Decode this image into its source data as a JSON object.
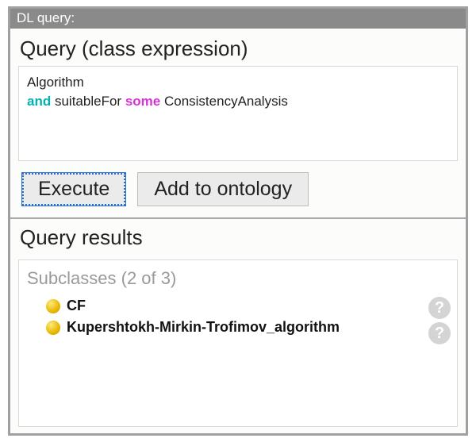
{
  "window": {
    "title": "DL query:"
  },
  "query": {
    "section_label": "Query (class expression)",
    "line1_token1": "Algorithm",
    "line2_kw_and": "and",
    "line2_token1": "suitableFor",
    "line2_kw_some": "some",
    "line2_token2": "ConsistencyAnalysis"
  },
  "buttons": {
    "execute": "Execute",
    "add_to_ontology": "Add to ontology"
  },
  "results": {
    "section_label": "Query results",
    "subclasses_label": "Subclasses (2 of 3)",
    "items": [
      {
        "label": "CF"
      },
      {
        "label": "Kupershtokh-Mirkin-Trofimov_algorithm"
      }
    ],
    "help_glyph": "?"
  }
}
